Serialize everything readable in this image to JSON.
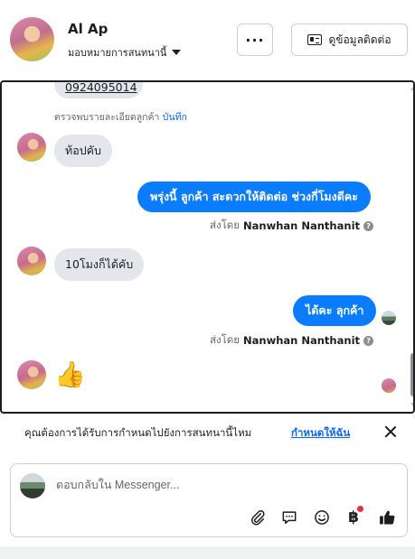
{
  "header": {
    "contact_name": "Al Ap",
    "assign_label": "มอบหมายการสนทนานี้",
    "more_label": "···",
    "contact_details_label": "ดูข้อมูลติดต่อ"
  },
  "conversation": {
    "phone_number": "0924095014",
    "details_prefix": "ตรวจพบรายละเอียดลูกค้า",
    "details_save": "บันทึก",
    "messages": [
      {
        "direction": "in",
        "text": "ท้อปคับ"
      },
      {
        "direction": "out",
        "text": "พรุ่งนี้ ลูกค้า  สะดวกให้ติดต่อ ช่วงกี่โมงดีคะ"
      },
      {
        "direction": "in",
        "text": "10โมงก็ได้คับ"
      },
      {
        "direction": "out",
        "text": "ได้คะ  ลุกค้า"
      },
      {
        "direction": "in",
        "text": "👍"
      }
    ],
    "sent_by_prefix": "ส่งโดย",
    "sent_by_name": "Nanwhan Nanthanit",
    "help_mark": "?"
  },
  "suggestion": {
    "text": "คุณต้องการได้รับการกำหนดไปยังการสนทนานี้ไหม",
    "link": "กำหนดให้ฉัน"
  },
  "composer": {
    "placeholder": "ตอบกลับใน Messenger...",
    "tools": [
      "paperclip-icon",
      "chat-bubble-icon",
      "emoji-icon",
      "baht-icon",
      "thumbs-up-icon"
    ],
    "baht_symbol": "฿"
  },
  "colors": {
    "accent": "#0a7cff",
    "link": "#0866ff",
    "bubble_in": "#e4e6eb",
    "notification_dot": "#f02849"
  }
}
